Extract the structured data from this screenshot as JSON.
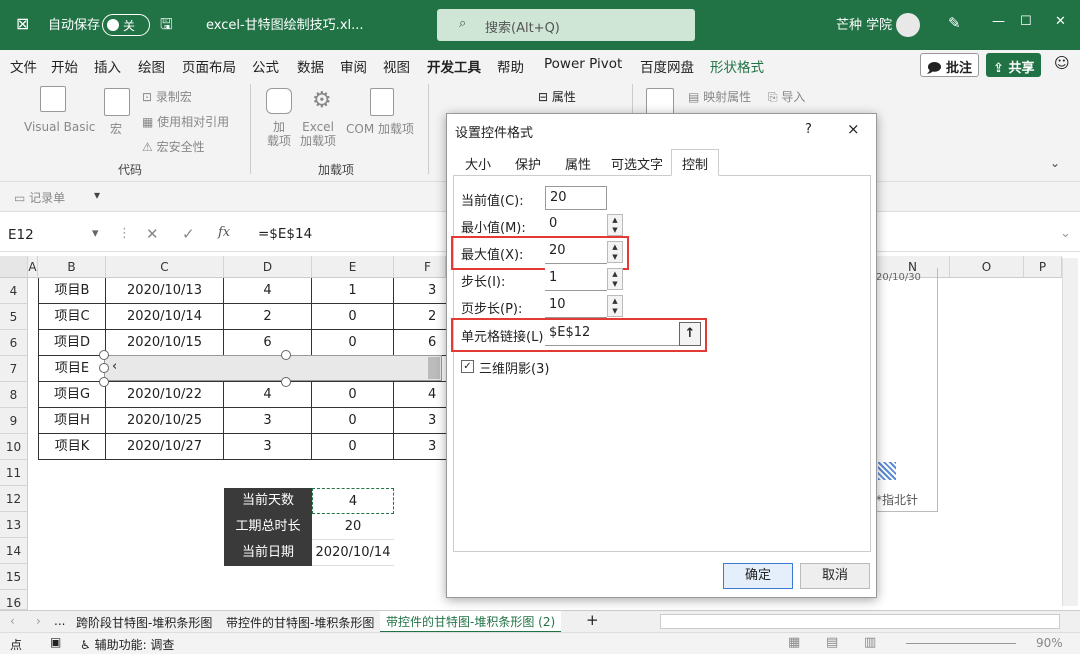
{
  "titlebar": {
    "autosave_label": "自动保存",
    "toggle_state": "关",
    "filename": "excel-甘特图绘制技巧.xl...",
    "search_placeholder": "搜索(Alt+Q)",
    "user": "芒种 学院"
  },
  "menu": {
    "items": [
      "文件",
      "开始",
      "插入",
      "绘图",
      "页面布局",
      "公式",
      "数据",
      "审阅",
      "视图",
      "开发工具",
      "帮助",
      "Power Pivot",
      "百度网盘",
      "形状格式"
    ],
    "active": "开发工具",
    "comment_btn": "批注",
    "share_btn": "共享"
  },
  "ribbon": {
    "visual_basic": "Visual Basic",
    "macro": "宏",
    "record_macro": "录制宏",
    "relative_ref": "使用相对引用",
    "macro_security": "宏安全性",
    "group_code": "代码",
    "addin": "加\n载项",
    "excel_addin": "Excel\n加载项",
    "com_addin": "COM 加载项",
    "group_addins": "加载项",
    "properties": "属性",
    "map_props": "映射属性",
    "import": "导入",
    "quick_access": "记录单"
  },
  "formula": {
    "namebox": "E12",
    "fx": "fx",
    "value": "=$E$14"
  },
  "columns": [
    "A",
    "B",
    "C",
    "D",
    "E",
    "F",
    "N",
    "O",
    "P"
  ],
  "rows": [
    {
      "num": "4",
      "b": "项目B",
      "c": "2020/10/13",
      "d": "4",
      "e": "1",
      "f": "3"
    },
    {
      "num": "5",
      "b": "项目C",
      "c": "2020/10/14",
      "d": "2",
      "e": "0",
      "f": "2"
    },
    {
      "num": "6",
      "b": "项目D",
      "c": "2020/10/15",
      "d": "6",
      "e": "0",
      "f": "6"
    },
    {
      "num": "7",
      "b": "项目E",
      "c": "",
      "d": "",
      "e": "",
      "f": ""
    },
    {
      "num": "8",
      "b": "项目G",
      "c": "2020/10/22",
      "d": "4",
      "e": "0",
      "f": "4"
    },
    {
      "num": "9",
      "b": "项目H",
      "c": "2020/10/25",
      "d": "3",
      "e": "0",
      "f": "3"
    },
    {
      "num": "10",
      "b": "项目K",
      "c": "2020/10/27",
      "d": "3",
      "e": "0",
      "f": "3"
    }
  ],
  "extra_rows": [
    "11",
    "12",
    "13",
    "14",
    "15",
    "16"
  ],
  "info": [
    {
      "label": "当前天数",
      "value": "4"
    },
    {
      "label": "工期总时长",
      "value": "20"
    },
    {
      "label": "当前日期",
      "value": "2020/10/14"
    }
  ],
  "chart_fragment": {
    "axis_date": "20/10/30",
    "legend": "*指北针"
  },
  "dialog": {
    "title": "设置控件格式",
    "help": "?",
    "close": "×",
    "tabs": [
      "大小",
      "保护",
      "属性",
      "可选文字",
      "控制"
    ],
    "active_tab": "控制",
    "fields": [
      {
        "label": "当前值(C):",
        "value": "20"
      },
      {
        "label": "最小值(M):",
        "value": "0"
      },
      {
        "label": "最大值(X):",
        "value": "20"
      },
      {
        "label": "步长(I):",
        "value": "1"
      },
      {
        "label": "页步长(P):",
        "value": "10"
      }
    ],
    "cell_link_label": "单元格链接(L):",
    "cell_link_value": "$E$12",
    "shading_label": "三维阴影(3)",
    "ok": "确定",
    "cancel": "取消"
  },
  "sheets": {
    "more": "...",
    "tabs": [
      "跨阶段甘特图-堆积条形图",
      "带控件的甘特图-堆积条形图",
      "带控件的甘特图-堆积条形图 (2)"
    ],
    "active": "带控件的甘特图-堆积条形图 (2)",
    "add": "+"
  },
  "status": {
    "ready": "点",
    "accessibility": "辅助功能: 调查",
    "zoom": "90%"
  }
}
